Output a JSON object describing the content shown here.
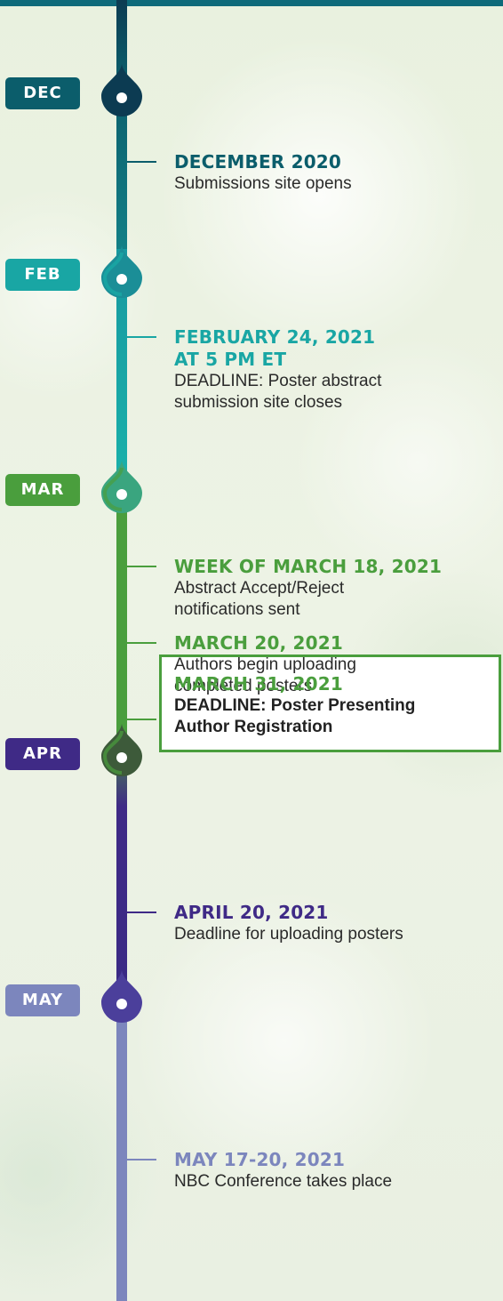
{
  "months": [
    {
      "label": "DEC",
      "color": "#0b5d6b"
    },
    {
      "label": "FEB",
      "color": "#19a6a4"
    },
    {
      "label": "MAR",
      "color": "#4a9e3d"
    },
    {
      "label": "APR",
      "color": "#3f2a86"
    },
    {
      "label": "MAY",
      "color": "#7c86bd"
    }
  ],
  "events": [
    {
      "date": "DECEMBER 2020",
      "description": "Submissions site opens",
      "color": "#0b5d6b"
    },
    {
      "date": "FEBRUARY 24, 2021\nAT 5 PM ET",
      "description": "DEADLINE: Poster abstract\nsubmission site closes",
      "color": "#19a6a4"
    },
    {
      "date": "WEEK OF MARCH 18, 2021",
      "description": "Abstract Accept/Reject\nnotifications sent",
      "color": "#4a9e3d"
    },
    {
      "date": "MARCH 20, 2021",
      "description": "Authors begin uploading\ncompleted posters",
      "color": "#4a9e3d"
    },
    {
      "date": "MARCH 31, 2021",
      "description": "DEADLINE: Poster Presenting\nAuthor Registration",
      "color": "#4a9e3d",
      "highlighted": true
    },
    {
      "date": "APRIL 20, 2021",
      "description": "Deadline for uploading posters",
      "color": "#3f2a86"
    },
    {
      "date": "MAY 17-20, 2021",
      "description": "NBC Conference takes place",
      "color": "#7c86bd"
    }
  ]
}
